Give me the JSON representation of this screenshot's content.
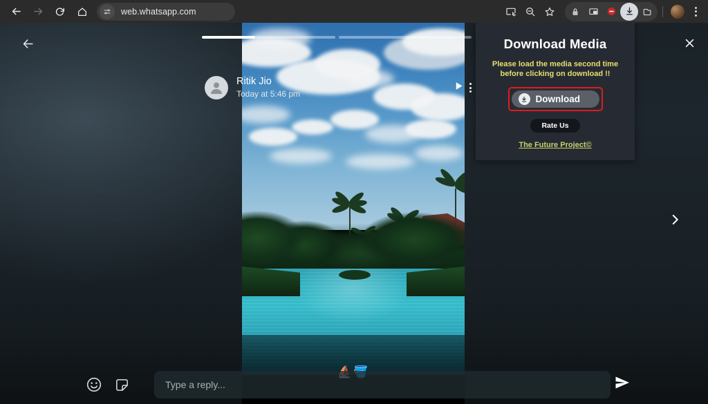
{
  "browser": {
    "back_label": "Back",
    "forward_label": "Forward",
    "reload_label": "Reload",
    "home_label": "Home",
    "url": "web.whatsapp.com",
    "site_info_icon": "page-settings-icon",
    "toolbar_icons": [
      "cast-icon",
      "zoom-icon",
      "bookmark-star-icon"
    ],
    "extension_icons": [
      "lock-extension-icon",
      "picture-in-picture-icon",
      "adblock-extension-icon",
      "download-extension-icon",
      "tab-extension-icon"
    ],
    "active_extension": "download-extension-icon",
    "profile_label": "Profile",
    "menu_label": "Customize and control"
  },
  "status_viewer": {
    "back_label": "Back",
    "next_label": "Next status",
    "contact_name": "Ritik Jio",
    "timestamp": "Today at 5:46 pm",
    "play_label": "Play",
    "more_label": "More options",
    "progress": [
      {
        "fill_percent": 40
      },
      {
        "fill_percent": 0
      }
    ],
    "media_emojis": "⛵🪣"
  },
  "reply_bar": {
    "emoji_icon": "emoji-smiley-icon",
    "sticker_icon": "sticker-icon",
    "placeholder": "Type a reply...",
    "value": "",
    "send_label": "Send"
  },
  "download_panel": {
    "title": "Download Media",
    "warning": "Please load the media second time before clicking on download !!",
    "download_label": "Download",
    "download_icon": "download-arrow-icon",
    "rate_label": "Rate Us",
    "link_label": "The Future Project©",
    "close_label": "Close",
    "highlight_color": "#e01b1b",
    "warning_color": "#e8de6e",
    "link_color": "#c8d06a",
    "panel_bg": "#262b33"
  }
}
